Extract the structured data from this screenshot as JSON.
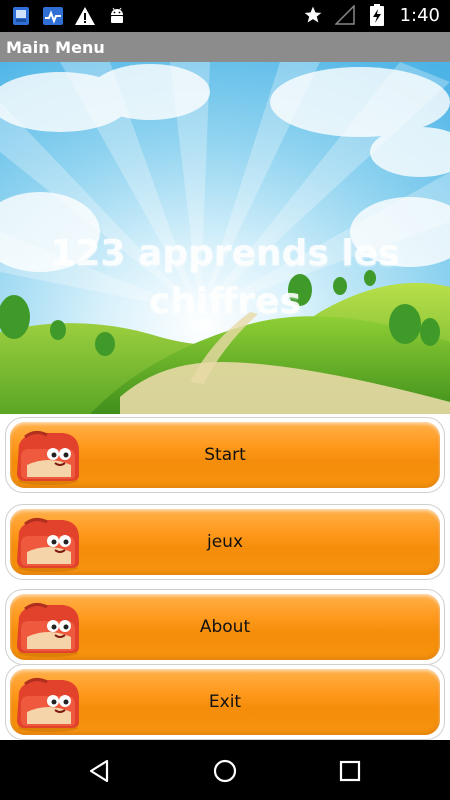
{
  "status_bar": {
    "time": "1:40",
    "icons_left": [
      "app-icon",
      "activity-icon",
      "warning-icon",
      "android-icon"
    ],
    "icons_right": [
      "star-icon",
      "signal-icon",
      "battery-charging-icon"
    ]
  },
  "action_bar": {
    "title": "Main Menu"
  },
  "hero": {
    "title": "123 apprends les chiffres"
  },
  "menu": {
    "items": [
      {
        "label": "Start"
      },
      {
        "label": "jeux"
      },
      {
        "label": "About"
      },
      {
        "label": "Exit"
      }
    ],
    "colors": {
      "button": "#f7950f",
      "button_light": "#ffb04a",
      "bag": "#e2412c"
    }
  },
  "nav_bar": {
    "icons": [
      "back-icon",
      "home-icon",
      "recents-icon"
    ]
  }
}
